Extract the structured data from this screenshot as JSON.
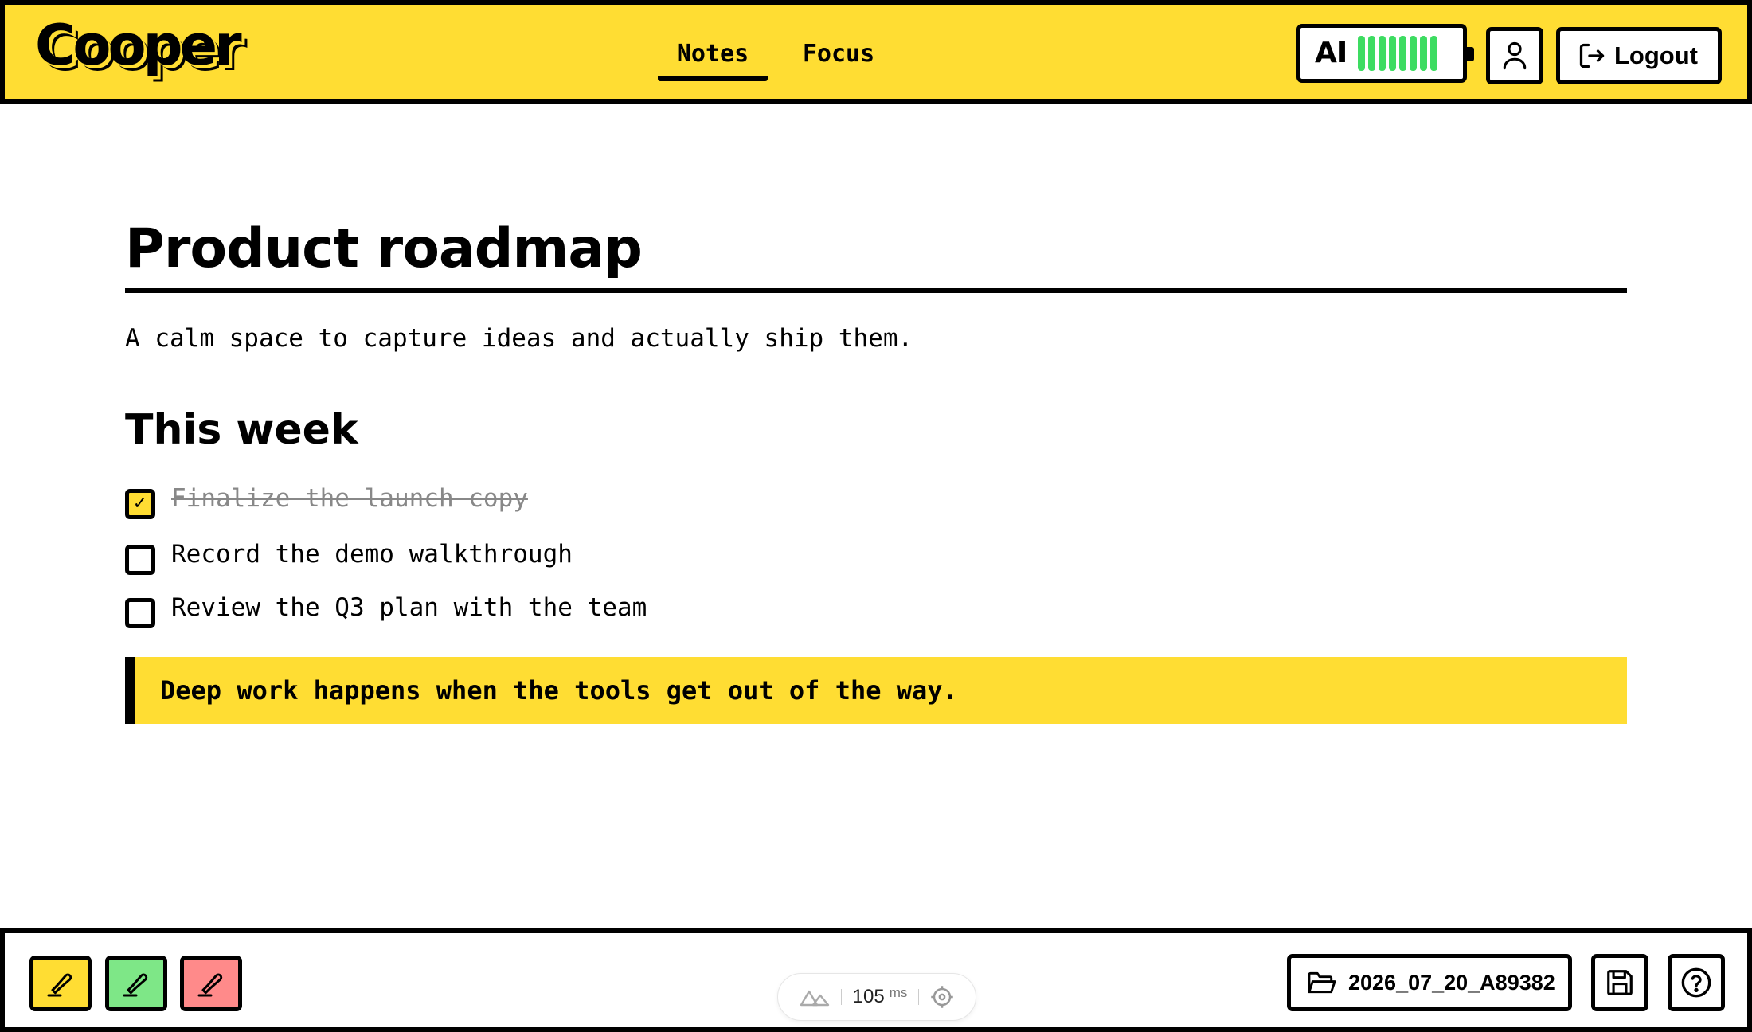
{
  "app": {
    "name": "Cooper"
  },
  "nav": {
    "tabs": [
      {
        "label": "Notes",
        "active": true
      },
      {
        "label": "Focus",
        "active": false
      }
    ]
  },
  "header": {
    "ai_badge": {
      "label": "AI",
      "battery_cells": 8,
      "cell_color": "#3DDC61"
    },
    "logout_label": "Logout"
  },
  "document": {
    "title": "Product roadmap",
    "subtitle": "A calm space to capture ideas and actually ship them.",
    "section_heading": "This week",
    "tasks": [
      {
        "text": "Finalize the launch copy",
        "done": true
      },
      {
        "text": "Record the demo walkthrough",
        "done": false
      },
      {
        "text": "Review the Q3 plan with the team",
        "done": false
      }
    ],
    "quote": "Deep work happens when the tools get out of the way."
  },
  "footer": {
    "highlighters": [
      {
        "color": "#FFDD33"
      },
      {
        "color": "#7EE787"
      },
      {
        "color": "#FF8A8A"
      }
    ],
    "latency": {
      "value": "105",
      "unit": "ms"
    },
    "file_name": "2026_07_20_A89382"
  },
  "colors": {
    "accent": "#FFDD33",
    "ink": "#000000"
  },
  "icons": [
    "user-icon",
    "logout-icon",
    "highlighter-icon",
    "mountains-icon",
    "target-icon",
    "folder-open-icon",
    "save-icon",
    "help-icon"
  ]
}
